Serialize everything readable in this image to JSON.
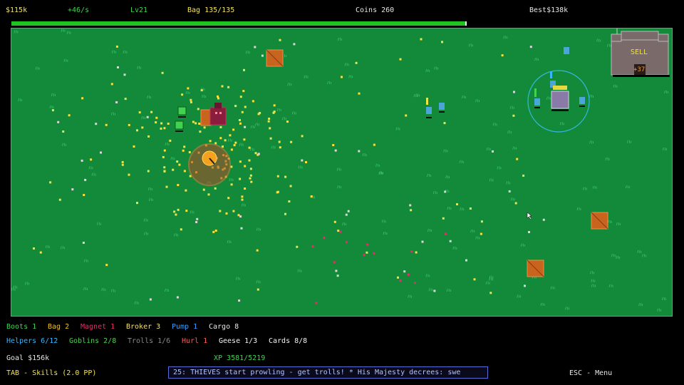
{
  "hud": {
    "money": "$115k",
    "rate": "+46/s",
    "level": "Lv21",
    "bag": "Bag 135/135",
    "coins": "Coins 260",
    "best": "Best$138k"
  },
  "xp_progress": 0.686,
  "castle": {
    "sign": "SELL",
    "tag": "+37"
  },
  "upgrades_row1": [
    {
      "label": "Boots 1",
      "color": "#3fd34f"
    },
    {
      "label": "Bag 2",
      "color": "#f0c020"
    },
    {
      "label": "Magnet 1",
      "color": "#e0306a"
    },
    {
      "label": "Broker 3",
      "color": "#f0e070"
    },
    {
      "label": "Pump 1",
      "color": "#3aa0ff"
    },
    {
      "label": "Cargo 8",
      "color": "#e8e8e8"
    }
  ],
  "upgrades_row2": [
    {
      "label": "Helpers 6/12",
      "color": "#38b6ff"
    },
    {
      "label": "Goblins 2/8",
      "color": "#4bd34b"
    },
    {
      "label": "Trolls 1/6",
      "color": "#8a8a8a"
    },
    {
      "label": "Hurl 1",
      "color": "#ff5a5a"
    },
    {
      "label": "Geese 1/3",
      "color": "#f4f4f4"
    },
    {
      "label": "Cards 8/8",
      "color": "#f4f4f4"
    }
  ],
  "goal": "Goal $156k",
  "xp": "XP 3581/5219",
  "ticker": "25: THIEVES start prowling - get trolls!    *    His Majesty decrees: swe",
  "skills_hint": "TAB - Skills (2.0 PP)",
  "menu_hint": "ESC - Menu",
  "colors": {
    "grass": "#138a3a",
    "coin": "#f4e040",
    "gem": "#d8d8d8",
    "helper": "#4aa6d8",
    "crate": "#c8641e"
  },
  "icons": {
    "player": "player-blob-icon",
    "crate": "crate-icon",
    "goblin": "goblin-icon",
    "troll": "troll-icon",
    "helper": "helper-icon",
    "castle": "castle-icon",
    "cursor": "mouse-cursor-icon"
  }
}
